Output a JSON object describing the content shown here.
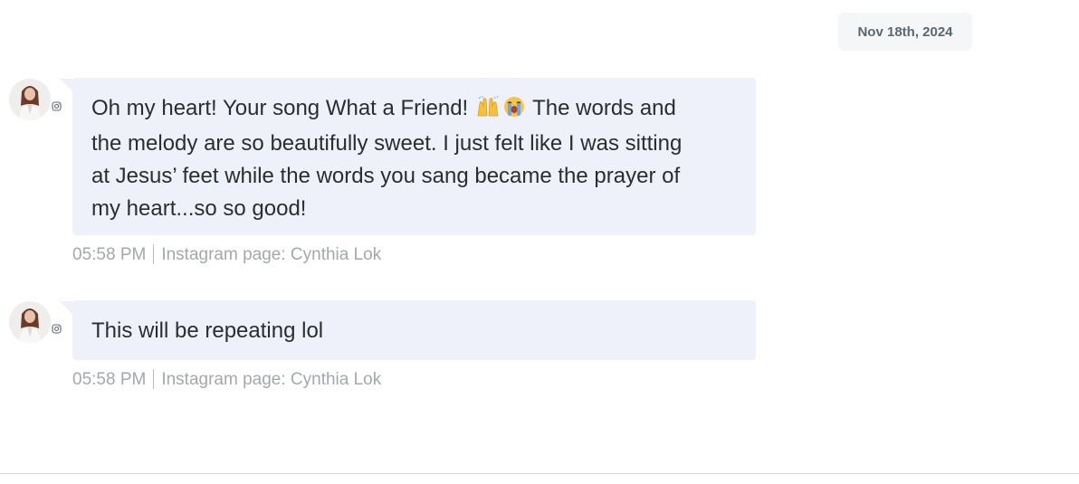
{
  "date_divider": "Nov 18th, 2024",
  "messages": [
    {
      "text_before": "Oh my heart! Your song What a Friend!",
      "emojis": [
        "raising-hands",
        "crying-face"
      ],
      "text_after": " The words and the melody are so beautifully sweet. I just felt like I was sitting at Jesus’ feet while the words you sang became the prayer of my heart...so so good!",
      "time": "05:58 PM",
      "source": "Instagram page: Cynthia Lok"
    },
    {
      "text_before": "This will be repeating lol",
      "emojis": [],
      "text_after": "",
      "time": "05:58 PM",
      "source": "Instagram page: Cynthia Lok"
    }
  ],
  "colors": {
    "bubble": "#eef1f9",
    "meta_text": "#a3a8ad",
    "date_chip_bg": "#f4f6f8"
  }
}
